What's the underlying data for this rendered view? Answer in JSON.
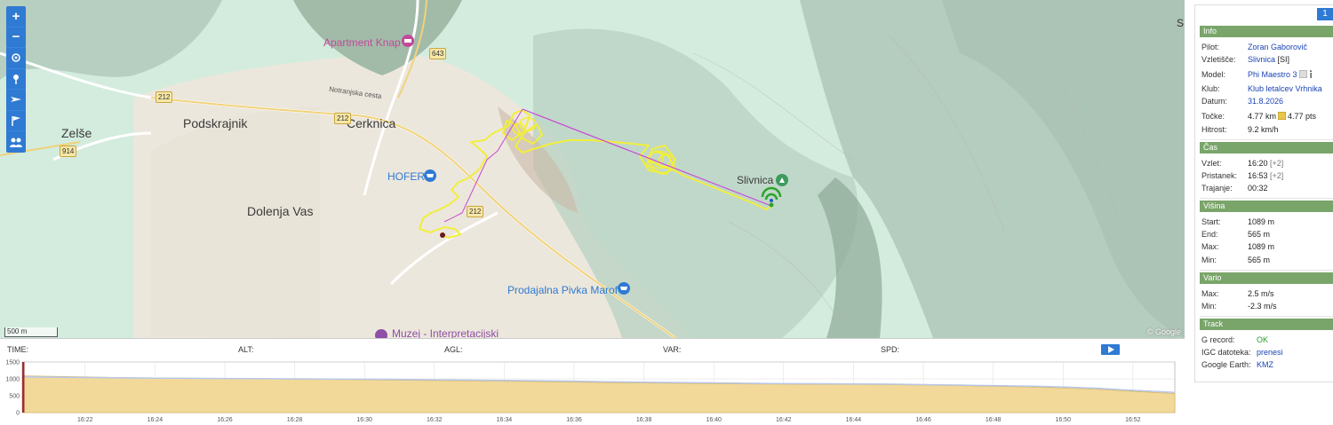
{
  "map": {
    "towns": [
      {
        "label": "Zelše"
      },
      {
        "label": "Podskrajnik"
      },
      {
        "label": "Cerknica"
      },
      {
        "label": "Dolenja Vas"
      },
      {
        "label": "Slivnica"
      }
    ],
    "pois": [
      {
        "label": "Apartment Knap",
        "color": "#c2499a"
      },
      {
        "label": "HOFER",
        "color": "#2f7ad3"
      },
      {
        "label": "Prodajalna Pivka Marof",
        "color": "#2f7ad3"
      },
      {
        "label": "Muzej - Interpretacijski",
        "color": "#8e4fa7"
      }
    ],
    "road_labels": [
      "Notranjska cesta"
    ],
    "road_shields": [
      "643",
      "212",
      "212",
      "212",
      "914"
    ],
    "edge_label": "S",
    "scale_label": "500 m",
    "attribution": "© Google",
    "toolbar": [
      {
        "icon": "zoom-in-icon",
        "symbol": "+"
      },
      {
        "icon": "zoom-out-icon",
        "symbol": "−"
      },
      {
        "icon": "locate-icon"
      },
      {
        "icon": "pin-icon"
      },
      {
        "icon": "glider-icon"
      },
      {
        "icon": "flag-icon"
      },
      {
        "icon": "group-icon"
      }
    ],
    "track_color": "#f1ee3c",
    "line_color": "#c84ad6"
  },
  "panel": {
    "page": "1",
    "sections": {
      "info": "Info",
      "cas": "Čas",
      "visina": "Višina",
      "vario": "Vario",
      "track": "Track"
    },
    "info": {
      "pilot_k": "Pilot:",
      "pilot_v": "Zoran Gaborovič",
      "vzletisce_k": "Vzletišče:",
      "vzletisce_v": "Slivnica",
      "vzletisce_c": "[SI]",
      "model_k": "Model:",
      "model_v": "Phi Maestro 3",
      "klub_k": "Klub:",
      "klub_v": "Klub letalcev Vrhnika",
      "datum_k": "Datum:",
      "datum_v": "31.8.2026",
      "tocke_k": "Točke:",
      "tocke_km": "4.77 km",
      "tocke_pts": "4.77 pts",
      "hitrost_k": "Hitrost:",
      "hitrost_v": "9.2 km/h"
    },
    "cas": {
      "vzlet_k": "Vzlet:",
      "vzlet_v": "16:20",
      "vzlet_tz": "[+2]",
      "pristanek_k": "Pristanek:",
      "pristanek_v": "16:53",
      "pristanek_tz": "[+2]",
      "trajanje_k": "Trajanje:",
      "trajanje_v": "00:32"
    },
    "visina": {
      "start_k": "Start:",
      "start_v": "1089 m",
      "end_k": "End:",
      "end_v": "565 m",
      "max_k": "Max:",
      "max_v": "1089 m",
      "min_k": "Min:",
      "min_v": "565 m"
    },
    "vario": {
      "max_k": "Max:",
      "max_v": "2.5 m/s",
      "min_k": "Min:",
      "min_v": "-2.3 m/s"
    },
    "track": {
      "grecord_k": "G record:",
      "grecord_v": "OK",
      "igc_k": "IGC datoteka:",
      "igc_v": "prenesi",
      "ge_k": "Google Earth:",
      "ge_v": "KMZ"
    }
  },
  "strip": {
    "time": "TIME:",
    "alt": "ALT:",
    "agl": "AGL:",
    "var": "VAR:",
    "spd": "SPD:"
  },
  "chart_data": {
    "type": "area",
    "title": "",
    "xlabel": "",
    "ylabel": "",
    "ylim": [
      0,
      1500
    ],
    "yticks": [
      "0",
      "500",
      "1000",
      "1500"
    ],
    "xticks": [
      "16:22",
      "16:24",
      "16:26",
      "16:28",
      "16:30",
      "16:32",
      "16:34",
      "16:36",
      "16:38",
      "16:40",
      "16:42",
      "16:44",
      "16:46",
      "16:48",
      "16:50",
      "16:52"
    ],
    "x_minutes": [
      20.2,
      21,
      22,
      23,
      24,
      25,
      26,
      27,
      28,
      29,
      30,
      31,
      32,
      33,
      34,
      35,
      36,
      37,
      38,
      39,
      40,
      41,
      42,
      43,
      44,
      45,
      46,
      47,
      48,
      49,
      50,
      51,
      52,
      53.2
    ],
    "series": [
      {
        "values": [
          1089,
          1075,
          1060,
          1040,
          1030,
          1020,
          1010,
          1000,
          990,
          985,
          975,
          965,
          950,
          940,
          930,
          920,
          905,
          890,
          880,
          870,
          860,
          850,
          845,
          840,
          835,
          830,
          815,
          800,
          780,
          760,
          730,
          690,
          630,
          565
        ],
        "color": "#f2d99a"
      },
      {
        "values": [
          1060,
          1050,
          1040,
          1030,
          1020,
          1015,
          1010,
          1005,
          1000,
          995,
          990,
          985,
          975,
          965,
          955,
          945,
          930,
          915,
          900,
          890,
          880,
          870,
          860,
          855,
          850,
          845,
          830,
          815,
          800,
          785,
          760,
          720,
          660,
          600
        ],
        "color": "#b9c8e8"
      }
    ]
  }
}
